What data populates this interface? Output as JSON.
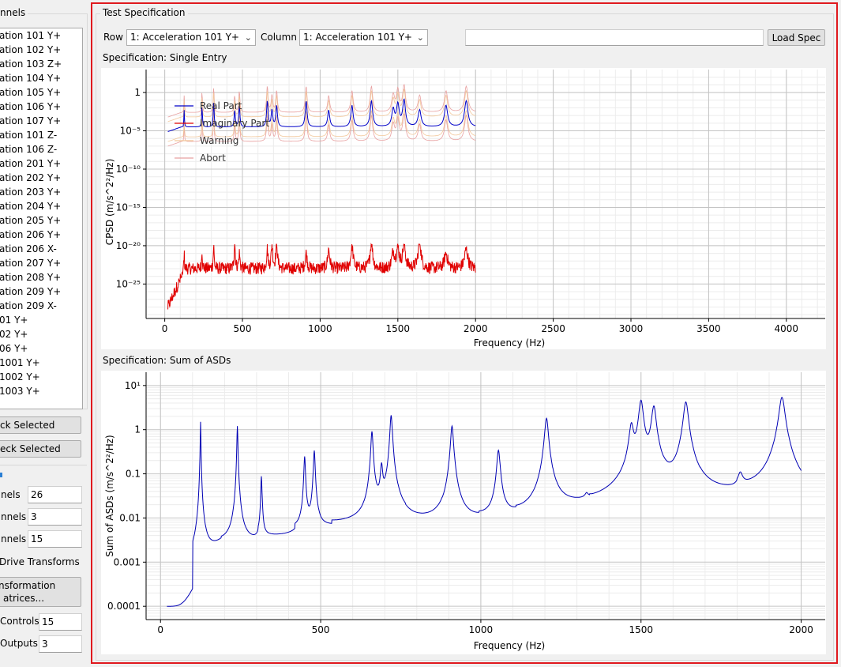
{
  "left_panel": {
    "channels_group_title": "nnels",
    "channel_list": [
      "ation 101 Y+",
      "ation 102 Y+",
      "ation 103 Z+",
      "ation 104 Y+",
      "ation 105 Y+",
      "ation 106 Y+",
      "ation 107 Y+",
      "ation 101 Z-",
      "ation 106 Z-",
      "ation 201 Y+",
      "ation 202 Y+",
      "ation 203 Y+",
      "ation 204 Y+",
      "ation 205 Y+",
      "ation 206 Y+",
      "ation 206 X-",
      "ation 207 Y+",
      "ation 208 Y+",
      "ation 209 Y+",
      "ation 209 X-",
      "01 Y+",
      "02 Y+",
      "06 Y+",
      " 1001 Y+",
      " 1002 Y+",
      " 1003 Y+"
    ],
    "check_selected_label": "ck Selected",
    "uncheck_selected_label": "eck Selected",
    "counts": [
      {
        "label": "nels",
        "value": "26"
      },
      {
        "label": "nnels",
        "value": "3"
      },
      {
        "label": "nnels",
        "value": "15"
      }
    ],
    "drive_transforms_label": " Drive Transforms",
    "transformation_button_line1": "nsformation",
    "transformation_button_line2": "atrices...",
    "controls_label": "Controls",
    "controls_value": "15",
    "outputs_label": "Outputs",
    "outputs_value": "3"
  },
  "test_spec": {
    "title": "Test Specification",
    "row_label": "Row",
    "row_value": "1: Acceleration 101 Y+",
    "column_label": "Column",
    "column_value": "1: Acceleration 101 Y+",
    "file_path": "",
    "load_spec_label": "Load Spec"
  },
  "single_entry": {
    "title": "Specification: Single Entry"
  },
  "sum_asds": {
    "title": "Specification: Sum of ASDs"
  },
  "colors": {
    "accent_frame": "#e0191e",
    "real": "#0000c8",
    "imag": "#e00000",
    "warning": "#f2c79a",
    "abort": "#e8a0a0"
  },
  "chart_data": [
    {
      "type": "line",
      "title": "",
      "xlabel": "Frequency (Hz)",
      "ylabel": "CPSD (m/s^2²/Hz)",
      "x_scale": "linear",
      "y_scale": "log",
      "xlim": [
        -120,
        4250
      ],
      "ylim_exp": [
        -29.5,
        3
      ],
      "x_ticks": [
        0,
        500,
        1000,
        1500,
        2000,
        2500,
        3000,
        3500,
        4000
      ],
      "y_ticks": [
        {
          "exp": 0,
          "label": "1"
        },
        {
          "exp": -5,
          "label": "10⁻⁵"
        },
        {
          "exp": -10,
          "label": "10⁻¹⁰"
        },
        {
          "exp": -15,
          "label": "10⁻¹⁵"
        },
        {
          "exp": -20,
          "label": "10⁻²⁰"
        },
        {
          "exp": -25,
          "label": "10⁻²⁵"
        }
      ],
      "grid": true,
      "legend_position": "top-left",
      "legend": [
        "Real Part",
        "Imaginary Part",
        "Warning",
        "Abort"
      ],
      "resonances_hz": [
        125,
        240,
        315,
        450,
        480,
        660,
        690,
        720,
        910,
        1055,
        1205,
        1330,
        1470,
        1500,
        1540,
        1640,
        1810,
        1940
      ],
      "series": [
        {
          "name": "Real Part",
          "color": "#0000c8",
          "x_range": [
            20,
            2000
          ],
          "approx_log10_y": {
            "baseline": -4.5,
            "peak": 0.5,
            "start": -5.1
          }
        },
        {
          "name": "Imaginary Part",
          "color": "#e00000",
          "x_range": [
            20,
            2000
          ],
          "approx_log10_y": {
            "start": -28,
            "baseline": -22,
            "peak": -20
          }
        },
        {
          "name": "Warning",
          "color": "#f2c79a",
          "offsets_log10": [
            1.3,
            -1.3
          ]
        },
        {
          "name": "Abort",
          "color": "#e8a0a0",
          "offsets_log10": [
            1.9,
            -1.9
          ]
        }
      ]
    },
    {
      "type": "line",
      "title": "",
      "xlabel": "Frequency (Hz)",
      "ylabel": "Sum of ASDs (m/s^2²/Hz)",
      "x_scale": "linear",
      "y_scale": "log",
      "xlim": [
        -45,
        2075
      ],
      "ylim": [
        5e-05,
        20
      ],
      "x_ticks": [
        0,
        500,
        1000,
        1500,
        2000
      ],
      "y_ticks": [
        {
          "value": 10,
          "label": "10¹"
        },
        {
          "value": 1,
          "label": "1"
        },
        {
          "value": 0.1,
          "label": "0.1"
        },
        {
          "value": 0.01,
          "label": "0.01"
        },
        {
          "value": 0.001,
          "label": "0.001"
        },
        {
          "value": 0.0001,
          "label": "0.0001"
        }
      ],
      "grid": true,
      "series": [
        {
          "name": "",
          "color": "#0000b4",
          "x_range": [
            20,
            2000
          ],
          "peaks": [
            [
              125,
              2.5
            ],
            [
              240,
              2.0
            ],
            [
              315,
              0.14
            ],
            [
              450,
              0.4
            ],
            [
              480,
              0.55
            ],
            [
              660,
              1.5
            ],
            [
              690,
              0.23
            ],
            [
              720,
              3.5
            ],
            [
              910,
              2.0
            ],
            [
              1055,
              0.55
            ],
            [
              1205,
              3.0
            ],
            [
              1330,
              0.012
            ],
            [
              1470,
              2.0
            ],
            [
              1500,
              7.5
            ],
            [
              1540,
              5.5
            ],
            [
              1640,
              7.0
            ],
            [
              1810,
              0.08
            ],
            [
              1940,
              9.0
            ]
          ],
          "start_value": 0.0001,
          "end_value": 0.06
        }
      ]
    }
  ]
}
